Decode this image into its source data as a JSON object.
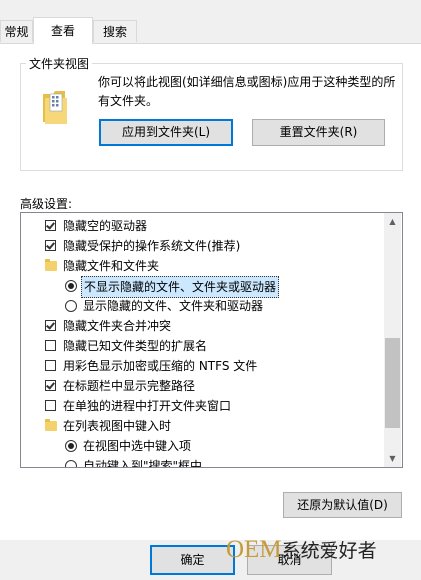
{
  "tabs": [
    {
      "label": "常规"
    },
    {
      "label": "查看"
    },
    {
      "label": "搜索"
    }
  ],
  "folder_view": {
    "title": "文件夹视图",
    "description_line1": "你可以将此视图(如详细信息或图标)应用于这种类型的所",
    "description_line2": "有文件夹。",
    "apply_button": "应用到文件夹(L)",
    "reset_button": "重置文件夹(R)"
  },
  "advanced": {
    "label": "高级设置:",
    "items": [
      {
        "type": "checkbox",
        "checked": true,
        "label": "隐藏空的驱动器"
      },
      {
        "type": "checkbox",
        "checked": true,
        "label": "隐藏受保护的操作系统文件(推荐)"
      },
      {
        "type": "folder",
        "label": "隐藏文件和文件夹"
      },
      {
        "type": "radio",
        "checked": true,
        "label": "不显示隐藏的文件、文件夹或驱动器",
        "selected": true
      },
      {
        "type": "radio",
        "checked": false,
        "label": "显示隐藏的文件、文件夹和驱动器"
      },
      {
        "type": "checkbox",
        "checked": true,
        "label": "隐藏文件夹合并冲突"
      },
      {
        "type": "checkbox",
        "checked": false,
        "label": "隐藏已知文件类型的扩展名"
      },
      {
        "type": "checkbox",
        "checked": false,
        "label": "用彩色显示加密或压缩的 NTFS 文件"
      },
      {
        "type": "checkbox",
        "checked": true,
        "label": "在标题栏中显示完整路径"
      },
      {
        "type": "checkbox",
        "checked": false,
        "label": "在单独的进程中打开文件夹窗口"
      },
      {
        "type": "folder",
        "label": "在列表视图中键入时"
      },
      {
        "type": "radio",
        "checked": true,
        "label": "在视图中选中键入项"
      },
      {
        "type": "radio",
        "checked": false,
        "label": "自动键入到\"搜索\"框中"
      }
    ],
    "restore_button": "还原为默认值(D)"
  },
  "footer": {
    "ok_button": "确定",
    "cancel_button": "取消"
  },
  "watermark": {
    "brand": "OEM",
    "text": "系统爱好者"
  }
}
